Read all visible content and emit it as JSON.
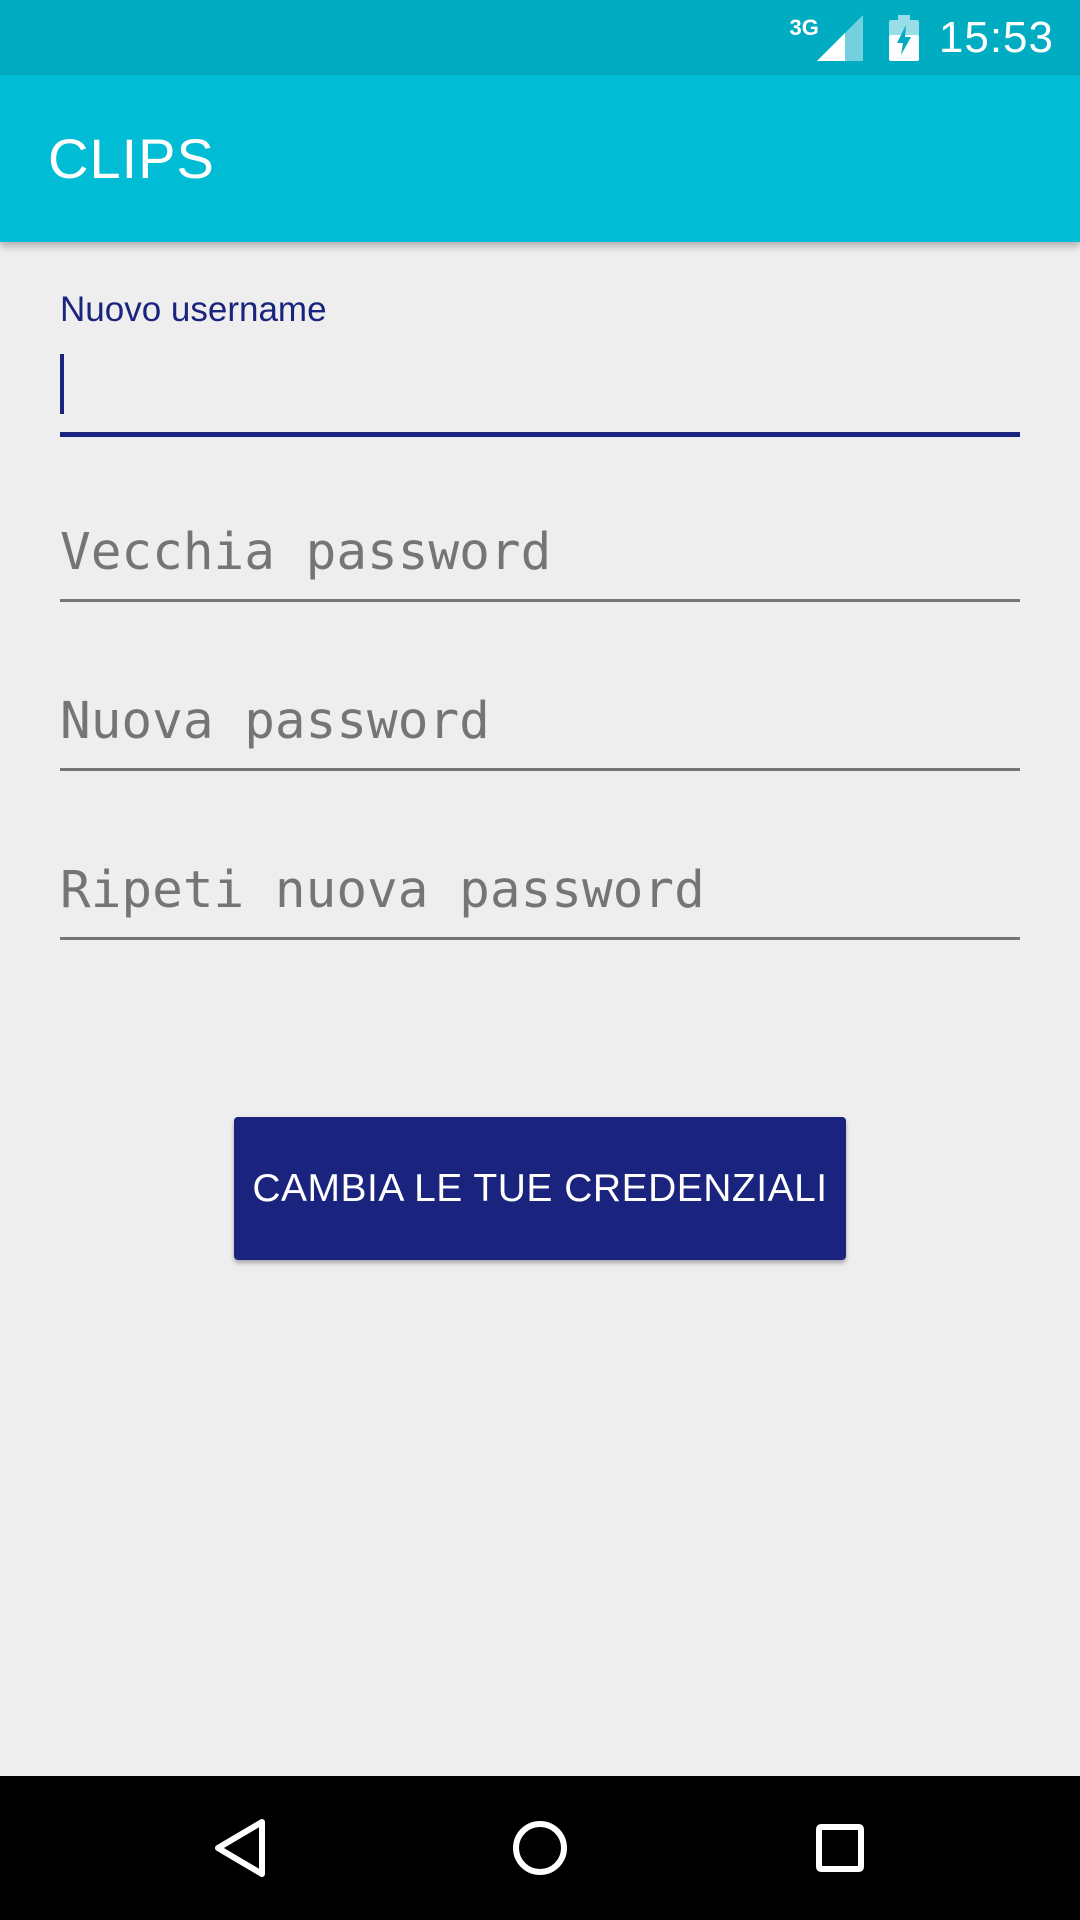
{
  "status_bar": {
    "network_type": "3G",
    "time": "15:53",
    "icons": [
      "signal-icon",
      "battery-charging-icon"
    ]
  },
  "app_bar": {
    "title": "CLIPS"
  },
  "form": {
    "username": {
      "label": "Nuovo username",
      "value": "",
      "focused": true
    },
    "old_password": {
      "placeholder": "Vecchia password",
      "value": ""
    },
    "new_password": {
      "placeholder": "Nuova password",
      "value": ""
    },
    "repeat_password": {
      "placeholder": "Ripeti nuova password",
      "value": ""
    },
    "submit_label": "CAMBIA LE TUE CREDENZIALI"
  },
  "nav_bar": {
    "icons": [
      "back-icon",
      "home-icon",
      "recents-icon"
    ]
  },
  "colors": {
    "status_bar": "#00acc1",
    "app_bar": "#00bcd4",
    "accent": "#1a237e",
    "background": "#eeeeee",
    "hint_text": "#757575"
  }
}
